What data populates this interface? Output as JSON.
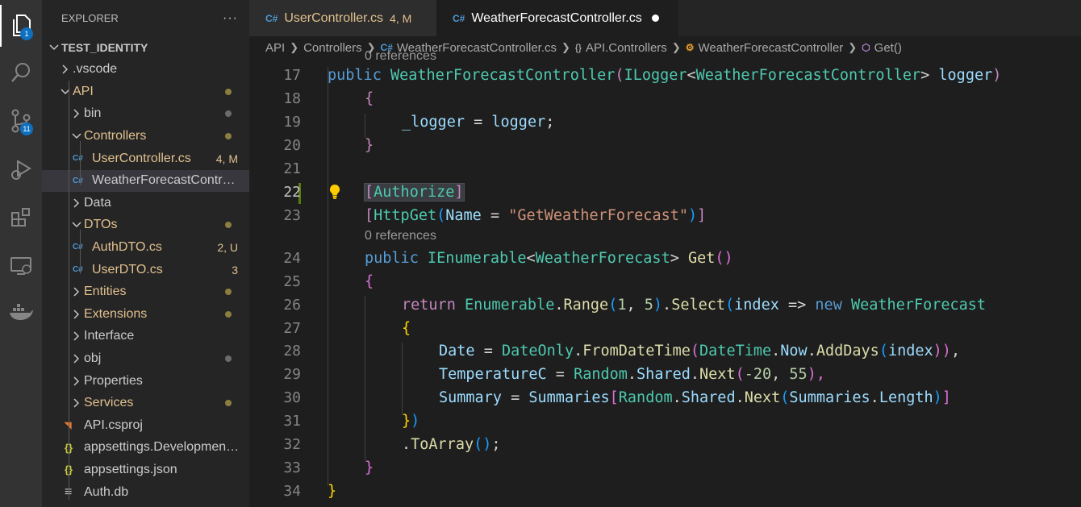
{
  "activity_bar": {
    "explorer_badge": "1",
    "scm_badge": "11"
  },
  "sidebar": {
    "title": "EXPLORER",
    "more_actions": "···",
    "tree": [
      {
        "label": "TEST_IDENTITY",
        "status": ""
      },
      {
        "label": ".vscode",
        "status": ""
      },
      {
        "label": "API",
        "status": ""
      },
      {
        "label": "bin",
        "status": ""
      },
      {
        "label": "Controllers",
        "status": ""
      },
      {
        "label": "UserController.cs",
        "status": "4, M"
      },
      {
        "label": "WeatherForecastController.cs",
        "status": ""
      },
      {
        "label": "Data",
        "status": ""
      },
      {
        "label": "DTOs",
        "status": ""
      },
      {
        "label": "AuthDTO.cs",
        "status": "2, U"
      },
      {
        "label": "UserDTO.cs",
        "status": "3"
      },
      {
        "label": "Entities",
        "status": ""
      },
      {
        "label": "Extensions",
        "status": ""
      },
      {
        "label": "Interface",
        "status": ""
      },
      {
        "label": "obj",
        "status": ""
      },
      {
        "label": "Properties",
        "status": ""
      },
      {
        "label": "Services",
        "status": ""
      },
      {
        "label": "API.csproj",
        "status": ""
      },
      {
        "label": "appsettings.Development.json",
        "status": ""
      },
      {
        "label": "appsettings.json",
        "status": ""
      },
      {
        "label": "Auth.db",
        "status": ""
      }
    ]
  },
  "tabs": [
    {
      "label": "UserController.cs",
      "status": "4, M"
    },
    {
      "label": "WeatherForecastController.cs",
      "status": ""
    }
  ],
  "breadcrumb": [
    "API",
    "Controllers",
    "WeatherForecastController.cs",
    "API.Controllers",
    "WeatherForecastController",
    "Get()"
  ],
  "codelens": {
    "top_partial": "0 references",
    "get_refs": "0 references"
  },
  "line_numbers": [
    "17",
    "18",
    "19",
    "20",
    "21",
    "22",
    "23",
    "24",
    "25",
    "26",
    "27",
    "28",
    "29",
    "30",
    "31",
    "32",
    "33",
    "34"
  ],
  "code": {
    "l17": [
      "public",
      "WeatherForecastController",
      "(",
      "ILogger",
      "<",
      "WeatherForecastController",
      ">",
      "logger",
      ")"
    ],
    "l18": [
      "{"
    ],
    "l19": [
      "_logger",
      " = ",
      "logger",
      ";"
    ],
    "l20": [
      "}"
    ],
    "l22": [
      "[",
      "Authorize",
      "]"
    ],
    "l23": [
      "[",
      "HttpGet",
      "(",
      "Name",
      " = ",
      "\"GetWeatherForecast\"",
      ")",
      "]"
    ],
    "l24": [
      "public",
      "IEnumerable",
      "<",
      "WeatherForecast",
      ">",
      "Get",
      "()"
    ],
    "l25": [
      "{"
    ],
    "l26": [
      "return",
      "Enumerable",
      ".",
      "Range",
      "(",
      "1",
      ", ",
      "5",
      ")",
      ".",
      "Select",
      "(",
      "index",
      " => ",
      "new",
      "WeatherForecast"
    ],
    "l27": [
      "{"
    ],
    "l28": [
      "Date",
      " = ",
      "DateOnly",
      ".",
      "FromDateTime",
      "(",
      "DateTime",
      ".",
      "Now",
      ".",
      "AddDays",
      "(",
      "index",
      "))",
      ","
    ],
    "l29": [
      "TemperatureC",
      " = ",
      "Random",
      ".",
      "Shared",
      ".",
      "Next",
      "(",
      "-20",
      ", ",
      "55",
      "),"
    ],
    "l30": [
      "Summary",
      " = ",
      "Summaries",
      "[",
      "Random",
      ".",
      "Shared",
      ".",
      "Next",
      "(",
      "Summaries",
      ".",
      "Length",
      ")",
      "]"
    ],
    "l31": [
      "}",
      ")"
    ],
    "l32": [
      ".",
      "ToArray",
      "()",
      ";"
    ],
    "l33": [
      "}"
    ],
    "l34": [
      "}"
    ]
  }
}
